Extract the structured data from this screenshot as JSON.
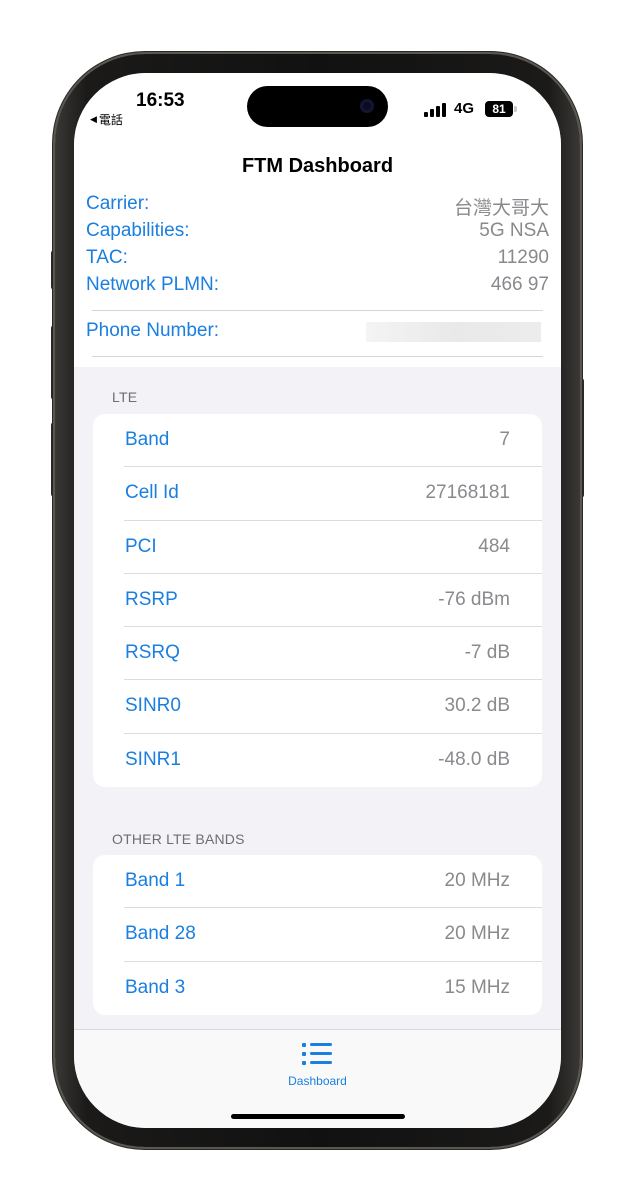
{
  "status_bar": {
    "time": "16:53",
    "back_app": "電話",
    "network": "4G",
    "battery": "81",
    "signal_bars": 4
  },
  "nav": {
    "title": "FTM Dashboard"
  },
  "info": {
    "carrier_label": "Carrier:",
    "carrier_value": "台灣大哥大",
    "capabilities_label": "Capabilities:",
    "capabilities_value": "5G NSA",
    "tac_label": "TAC:",
    "tac_value": "11290",
    "plmn_label": "Network PLMN:",
    "plmn_value": "466 97",
    "phone_label": "Phone Number:"
  },
  "lte": {
    "header": "LTE",
    "rows": [
      {
        "label": "Band",
        "value": "7"
      },
      {
        "label": "Cell Id",
        "value": "27168181"
      },
      {
        "label": "PCI",
        "value": "484"
      },
      {
        "label": "RSRP",
        "value": "-76 dBm"
      },
      {
        "label": "RSRQ",
        "value": "-7 dB"
      },
      {
        "label": "SINR0",
        "value": "30.2 dB"
      },
      {
        "label": "SINR1",
        "value": "-48.0 dB"
      }
    ]
  },
  "other_lte": {
    "header": "OTHER LTE BANDS",
    "rows": [
      {
        "label": "Band 1",
        "value": "20 MHz"
      },
      {
        "label": "Band 28",
        "value": "20 MHz"
      },
      {
        "label": "Band 3",
        "value": "15 MHz"
      }
    ]
  },
  "tab_bar": {
    "icon": "list-bullet-icon",
    "label": "Dashboard"
  },
  "colors": {
    "accent": "#1a7fe0",
    "secondary_text": "#8a8a8e",
    "grouped_background": "#f2f2f7"
  }
}
